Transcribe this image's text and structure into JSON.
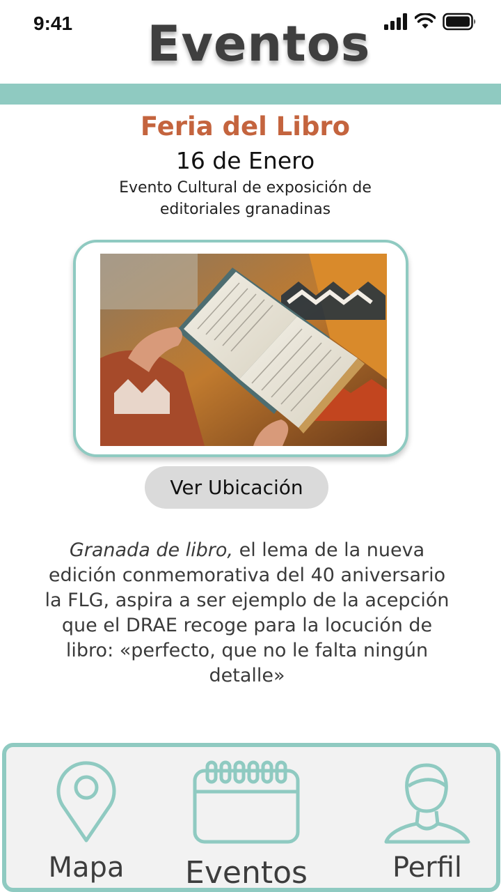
{
  "status_bar": {
    "time": "9:41"
  },
  "header": {
    "title": "Eventos"
  },
  "event": {
    "title": "Feria del Libro",
    "date": "16 de Enero",
    "subtitle": "Evento Cultural de exposición de editoriales granadinas",
    "image_icon": "book-photo"
  },
  "location_button": {
    "label": "Ver Ubicación"
  },
  "description": {
    "lead_italic": "Granada de libro,",
    "rest": " el lema de la nueva edición conmemorativa del 40 aniversario la FLG, aspira a ser ejemplo de la acepción que el DRAE recoge para la locución de libro: «perfecto, que no le falta ningún detalle»"
  },
  "nav": {
    "items": [
      {
        "label": "Mapa",
        "icon": "map-pin-icon"
      },
      {
        "label": "Eventos",
        "icon": "calendar-icon"
      },
      {
        "label": "Perfil",
        "icon": "user-icon"
      }
    ]
  },
  "colors": {
    "accent": "#8fcac1",
    "title": "#c4643e",
    "button": "#dadada"
  }
}
